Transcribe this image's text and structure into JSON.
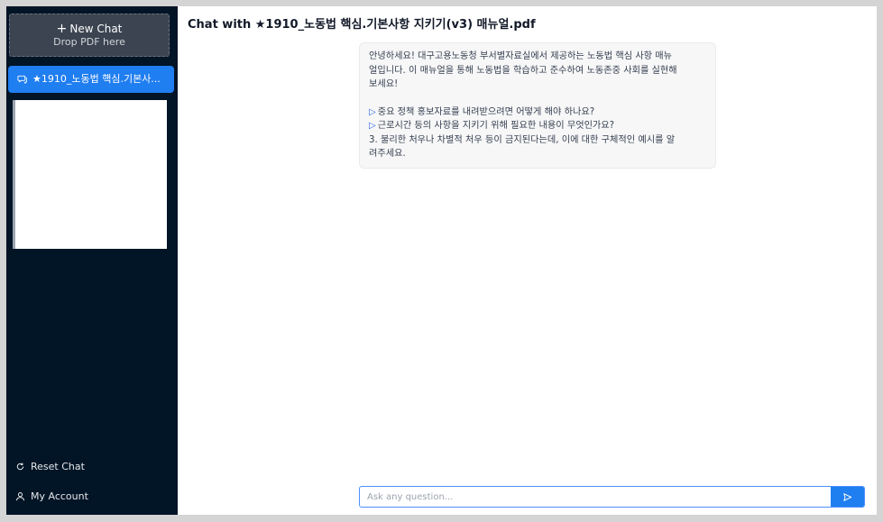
{
  "sidebar": {
    "new_chat": {
      "label": "New Chat",
      "plus": "+",
      "sub": "Drop PDF here"
    },
    "chats": [
      {
        "label": "★1910_노동법 핵심.기본사...",
        "icon": "chat-icon"
      }
    ],
    "reset_label": "Reset Chat",
    "account_label": "My Account"
  },
  "main": {
    "title": "Chat with ★1910_노동법 핵심.기본사항 지키기(v3) 매뉴얼.pdf",
    "message": {
      "intro": [
        "안녕하세요! 대구고용노동청 부서별자료실에서 제공하는 노동법 핵심 사항 매뉴",
        "얼입니다. 이 매뉴얼을 통해 노동법을 학습하고 준수하여 노동존중 사회를 실현해",
        "보세요!"
      ],
      "questions": [
        {
          "marker": "▷",
          "text": "중요 정책 홍보자료를 내려받으려면 어떻게 해야 하나요?"
        },
        {
          "marker": "▷",
          "text": "근로시간 등의 사항을 지키기 위해 필요한 내용이 무엇인가요?"
        }
      ],
      "q3": [
        "3. 불리한 처우나 차별적 처우 등이 금지된다는데, 이에 대한 구체적인 예시를 알",
        "려주세요."
      ]
    },
    "input": {
      "placeholder": "Ask any question...",
      "value": ""
    }
  },
  "colors": {
    "sidebar_bg": "#021526",
    "accent": "#1f7ef0"
  }
}
